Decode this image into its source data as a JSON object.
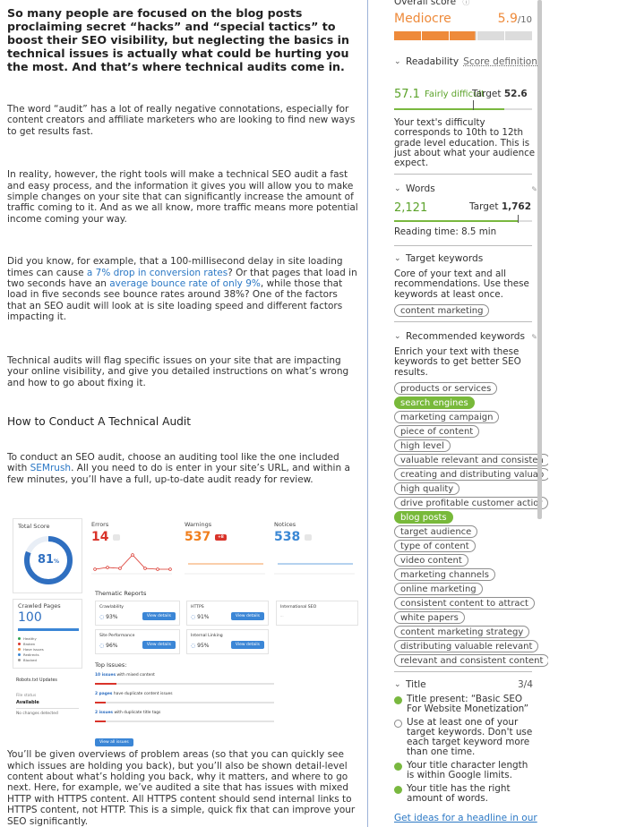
{
  "article": {
    "intro": "So many people are focused on the blog posts proclaiming secret “hacks” and “special tactics” to boost their SEO visibility, but neglecting the basics in technical issues is actually what could be hurting you the most. And that’s where technical audits come in.",
    "p1": "The word “audit” has a lot of really negative connotations, especially for content creators and affiliate marketers who are looking to find new ways to get results fast.",
    "p2": "In reality, however, the right tools will make a technical SEO audit a fast and easy process, and the information it gives you will allow you to make simple changes on your site that can significantly increase the amount of traffic coming to it. And as we all know, more traffic means more potential income coming your way.",
    "p3_a": "Did you know, for example, that a 100-millisecond delay in site loading times can cause ",
    "p3_link1": "a 7% drop in conversion rates",
    "p3_b": "? Or that pages that load in two seconds have an ",
    "p3_link2": "average bounce rate of only 9%",
    "p3_c": ", while those that load in five seconds see bounce rates around 38%? One of the factors that an SEO audit will look at is site loading speed and different factors impacting it.",
    "p4": "Technical audits will flag specific issues on your site that are impacting your online visibility, and give you detailed instructions on what’s wrong and how to go about fixing it.",
    "heading": "How to Conduct A Technical Audit",
    "p5_a": "To conduct an SEO audit, choose an auditing tool like the one included with ",
    "p5_link": "SEMrush",
    "p5_b": ". All you need to do is enter in your site’s URL, and within a few minutes, you’ll have a full, up-to-date audit ready for review.",
    "p6": "You’ll be given overviews of problem areas (so that you can quickly see which issues are holding you back), but you’ll also be shown detail-level content about what’s holding you back, why it matters, and where to go next. Here, for example, we’ve audited a site that has issues with mixed HTTP with HTTPS content. All HTTPS content should send internal links to HTTPS content, not HTTP. This is a simple, quick fix that can improve your SEO significantly."
  },
  "dashboard": {
    "total_score_label": "Total Score",
    "total_score": "81",
    "total_score_unit": "%",
    "crawled_label": "Crawled Pages",
    "crawled_value": "100",
    "legend": [
      "Healthy",
      "Broken",
      "Have issues",
      "Redirects",
      "Blocked"
    ],
    "errors_label": "Errors",
    "errors_value": "14",
    "warnings_label": "Warnings",
    "warnings_value": "537",
    "warnings_badge": "+8",
    "notices_label": "Notices",
    "notices_value": "538",
    "thematic_label": "Thematic Reports",
    "reports": [
      {
        "name": "Crawlability",
        "value": "93%"
      },
      {
        "name": "HTTPS",
        "value": "91%"
      },
      {
        "name": "Site Performance",
        "value": "96%"
      },
      {
        "name": "Internal Linking",
        "value": "95%"
      }
    ],
    "intl_name": "International SEO",
    "view_details": "View details",
    "top_issues_label": "Top Issues:",
    "issues": [
      {
        "count": "10 issues",
        "text": "with mixed content"
      },
      {
        "count": "2 pages",
        "text": "have duplicate content issues"
      },
      {
        "count": "2 issues",
        "text": "with duplicate title tags"
      }
    ],
    "view_all": "View all issues",
    "robots_title": "Robots.txt Updates",
    "file_status_label": "File status",
    "file_status": "Available",
    "no_changes": "No changes detected"
  },
  "panel": {
    "overall_label": "Overall score",
    "overall_rating": "Mediocre",
    "overall_value": "5.9",
    "overall_max": "/10",
    "overall_fraction": 0.59,
    "readability": {
      "title": "Readability",
      "score_def": "Score definition",
      "value": "57.1",
      "label": "Fairly difficult",
      "target_label": "Target",
      "target": "52.6",
      "desc": "Your text's difficulty corresponds to 10th to 12th grade level education. This is just about what your audience expect."
    },
    "words": {
      "title": "Words",
      "value": "2,121",
      "target_label": "Target",
      "target": "1,762",
      "reading_time": "Reading time: 8.5 min"
    },
    "target_keywords": {
      "title": "Target keywords",
      "desc": "Core of your text and all recommendations. Use these keywords at least once.",
      "keywords": [
        "content marketing"
      ]
    },
    "recommended": {
      "title": "Recommended keywords",
      "desc": "Enrich your text with these keywords to get better SEO results.",
      "keywords": [
        {
          "text": "products or services",
          "used": false
        },
        {
          "text": "search engines",
          "used": true
        },
        {
          "text": "marketing campaign",
          "used": false
        },
        {
          "text": "piece of content",
          "used": false
        },
        {
          "text": "high level",
          "used": false
        },
        {
          "text": "valuable relevant and consisten",
          "used": false
        },
        {
          "text": "creating and distributing valuab",
          "used": false
        },
        {
          "text": "high quality",
          "used": false
        },
        {
          "text": "drive profitable customer actior",
          "used": false
        },
        {
          "text": "blog posts",
          "used": true
        },
        {
          "text": "target audience",
          "used": false
        },
        {
          "text": "type of content",
          "used": false
        },
        {
          "text": "video content",
          "used": false
        },
        {
          "text": "marketing channels",
          "used": false
        },
        {
          "text": "online marketing",
          "used": false
        },
        {
          "text": "consistent content to attract",
          "used": false
        },
        {
          "text": "white papers",
          "used": false
        },
        {
          "text": "content marketing strategy",
          "used": false
        },
        {
          "text": "distributing valuable relevant",
          "used": false
        },
        {
          "text": "relevant and consistent content",
          "used": false
        }
      ]
    },
    "title_section": {
      "title": "Title",
      "count": "3/4",
      "items": [
        {
          "text": "Title present: “Basic SEO For Website Monetization”",
          "ok": true
        },
        {
          "text": "Use at least one of your target keywords. Don't use each target keyword more than one time.",
          "ok": false
        },
        {
          "text": "Your title character length is within Google limits.",
          "ok": true
        },
        {
          "text": "Your title has the right amount of words.",
          "ok": true
        }
      ],
      "ideas_link": "Get ideas for a headline in our"
    }
  },
  "colors": {
    "link": "#2b78c5",
    "green": "#79b83f",
    "orange": "#ee8a3a",
    "error_red": "#d9332a",
    "warn_orange": "#f07e1b",
    "notice_blue": "#3a87d4"
  }
}
